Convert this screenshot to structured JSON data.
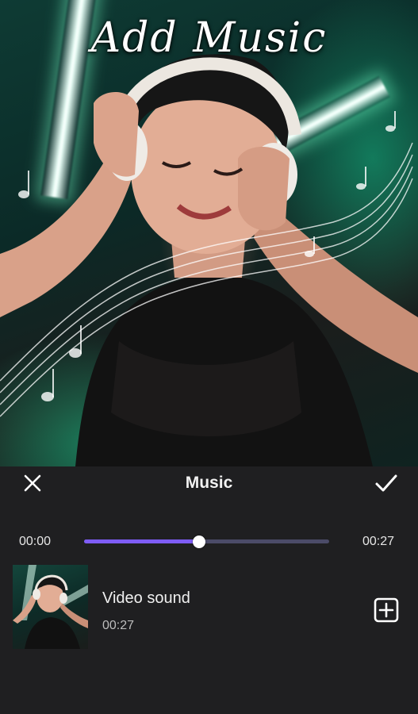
{
  "preview": {
    "overlay_title": "Add Music"
  },
  "toolbar": {
    "close_icon": "close-icon",
    "title": "Music",
    "confirm_icon": "checkmark-icon"
  },
  "player": {
    "current_time": "00:00",
    "total_time": "00:27",
    "progress_fraction": 0.47,
    "accent_color": "#7e5cf5",
    "track_color": "#4b4b68"
  },
  "music_list": [
    {
      "name": "Video sound",
      "duration": "00:27",
      "action_icon": "add-square-icon"
    }
  ]
}
